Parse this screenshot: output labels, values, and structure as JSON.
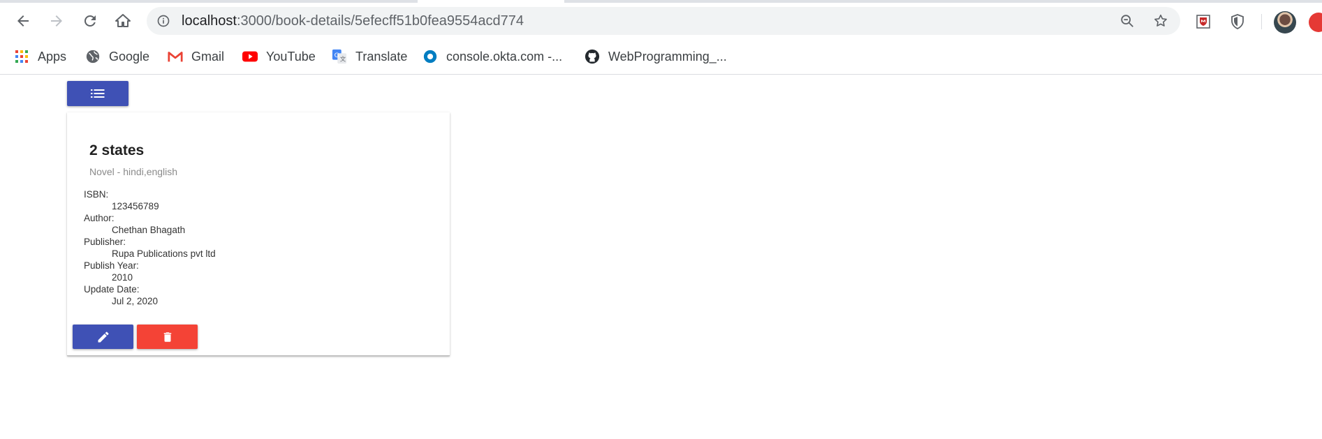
{
  "browser": {
    "url_host": "localhost",
    "url_path": ":3000/book-details/5efecff51b0fea9554acd774",
    "bookmarks": [
      {
        "label": "Apps",
        "icon": "apps-grid-icon"
      },
      {
        "label": "Google",
        "icon": "globe-icon"
      },
      {
        "label": "Gmail",
        "icon": "gmail-icon"
      },
      {
        "label": "YouTube",
        "icon": "youtube-icon"
      },
      {
        "label": "Translate",
        "icon": "translate-icon"
      },
      {
        "label": "console.okta.com -...",
        "icon": "okta-icon"
      },
      {
        "label": "WebProgramming_...",
        "icon": "github-icon"
      }
    ]
  },
  "book": {
    "title": "2 states",
    "subtitle": "Novel - hindi,english",
    "fields": [
      {
        "label": "ISBN:",
        "value": "123456789"
      },
      {
        "label": "Author:",
        "value": "Chethan Bhagath"
      },
      {
        "label": "Publisher:",
        "value": "Rupa Publications pvt ltd"
      },
      {
        "label": "Publish Year:",
        "value": "2010"
      },
      {
        "label": "Update Date:",
        "value": "Jul 2, 2020"
      }
    ]
  },
  "colors": {
    "primary": "#3f51b5",
    "danger": "#f44336"
  }
}
